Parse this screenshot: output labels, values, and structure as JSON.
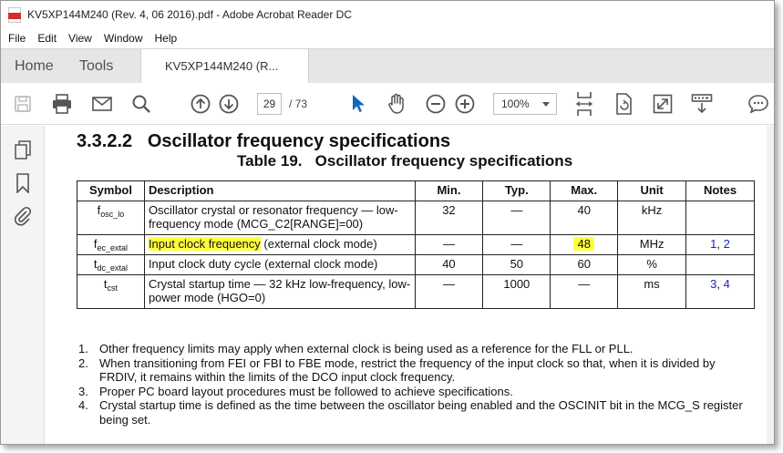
{
  "window": {
    "title": "KV5XP144M240 (Rev. 4, 06 2016).pdf - Adobe Acrobat Reader DC"
  },
  "menu": [
    "File",
    "Edit",
    "View",
    "Window",
    "Help"
  ],
  "tabs": {
    "home": "Home",
    "tools": "Tools",
    "document": "KV5XP144M240 (R..."
  },
  "toolbar": {
    "page_current": "29",
    "page_total": "/ 73",
    "zoom": "100%"
  },
  "document": {
    "section_heading": "3.3.2.2   Oscillator frequency specifications",
    "table_title": "Table 19.   Oscillator frequency specifications",
    "table": {
      "headers": [
        "Symbol",
        "Description",
        "Min.",
        "Typ.",
        "Max.",
        "Unit",
        "Notes"
      ],
      "rows": [
        {
          "symbol_main": "f",
          "symbol_sub": "osc_lo",
          "description": "Oscillator crystal or resonator frequency — low-frequency mode (MCG_C2[RANGE]=00)",
          "description_rest": "",
          "min": "32",
          "typ": "—",
          "max": "40",
          "unit": "kHz",
          "notes_a": "",
          "notes_sep": "",
          "notes_b": ""
        },
        {
          "symbol_main": "f",
          "symbol_sub": "ec_extal",
          "description": "Input clock frequency",
          "description_rest": " (external clock mode)",
          "min": "—",
          "typ": "—",
          "max": "48",
          "unit": "MHz",
          "notes_a": "1",
          "notes_sep": ", ",
          "notes_b": "2"
        },
        {
          "symbol_main": "t",
          "symbol_sub": "dc_extal",
          "description": "Input clock duty cycle (external clock mode)",
          "description_rest": "",
          "min": "40",
          "typ": "50",
          "max": "60",
          "unit": "%",
          "notes_a": "",
          "notes_sep": "",
          "notes_b": ""
        },
        {
          "symbol_main": "t",
          "symbol_sub": "cst",
          "description": "Crystal startup time — 32 kHz low-frequency, low-power mode (HGO=0)",
          "description_rest": "",
          "min": "—",
          "typ": "1000",
          "max": "—",
          "unit": "ms",
          "notes_a": "3",
          "notes_sep": ", ",
          "notes_b": "4"
        }
      ]
    },
    "notes": [
      {
        "num": "1.",
        "text": "Other frequency limits may apply when external clock is being used as a reference for the FLL or PLL."
      },
      {
        "num": "2.",
        "text": "When transitioning from FEI or FBI to FBE mode, restrict the frequency of the input clock so that, when it is divided by FRDIV, it remains within the limits of the DCO input clock frequency."
      },
      {
        "num": "3.",
        "text": "Proper PC board layout procedures must be followed to achieve specifications."
      },
      {
        "num": "4.",
        "text": "Crystal startup time is defined as the time between the oscillator being enabled and the OSCINIT bit in the MCG_S register being set."
      }
    ]
  },
  "colors": {
    "highlight": "#ffff3b",
    "link": "#1a25c4",
    "select_tool": "#1565c0",
    "pdf_red": "#d32f2f"
  },
  "icons": [
    "pdf-file-icon",
    "save-icon",
    "print-icon",
    "email-icon",
    "search-icon",
    "prev-page-icon",
    "next-page-icon",
    "select-cursor-icon",
    "hand-tool-icon",
    "zoom-out-icon",
    "zoom-in-icon",
    "fit-page-icon",
    "rotate-icon",
    "fullscreen-icon",
    "keyboard-icon",
    "comment-icon",
    "page-thumbnails-icon",
    "bookmarks-icon",
    "attachments-icon"
  ]
}
